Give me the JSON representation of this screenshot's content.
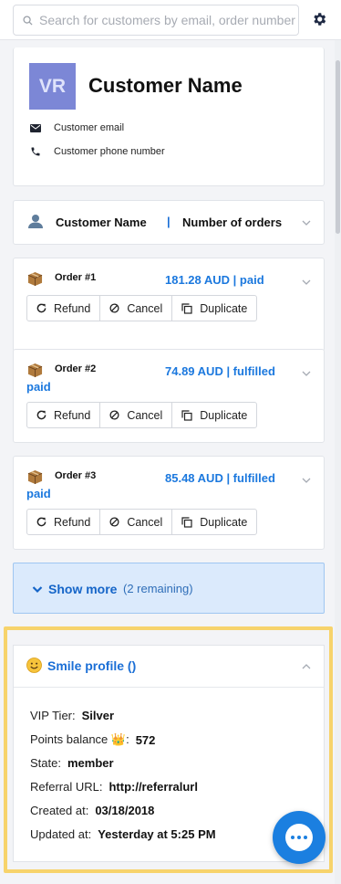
{
  "search": {
    "placeholder": "Search for customers by email, order number"
  },
  "profile": {
    "initials": "VR",
    "name": "Customer Name",
    "email": "Customer email",
    "phone": "Customer phone number"
  },
  "summary": {
    "name": "Customer Name",
    "separator": "|",
    "orders": "Number of orders"
  },
  "orders": [
    {
      "number": "Order #1",
      "status": "181.28 AUD | paid"
    },
    {
      "number": "Order #2",
      "status": "74.89 AUD | fulfilled paid"
    },
    {
      "number": "Order #3",
      "status": "85.48 AUD | fulfilled paid"
    }
  ],
  "order_actions": {
    "refund": "Refund",
    "cancel": "Cancel",
    "duplicate": "Duplicate"
  },
  "show_more": {
    "label": "Show more",
    "remaining": "(2 remaining)"
  },
  "smile": {
    "title": "Smile profile ()",
    "rows": [
      {
        "key": "VIP Tier:",
        "value": "Silver"
      },
      {
        "key": "Points balance 👑:",
        "value": "572"
      },
      {
        "key": "State:",
        "value": "member"
      },
      {
        "key": "Referral URL:",
        "value": "http://referralurl"
      },
      {
        "key": "Created at:",
        "value": "03/18/2018"
      },
      {
        "key": "Updated at:",
        "value": "Yesterday at 5:25 PM"
      }
    ]
  },
  "colors": {
    "accent": "#1b78de",
    "highlight": "#f7d36b",
    "avatar": "#7c87d6",
    "show_more_bg": "#dbeafc"
  }
}
